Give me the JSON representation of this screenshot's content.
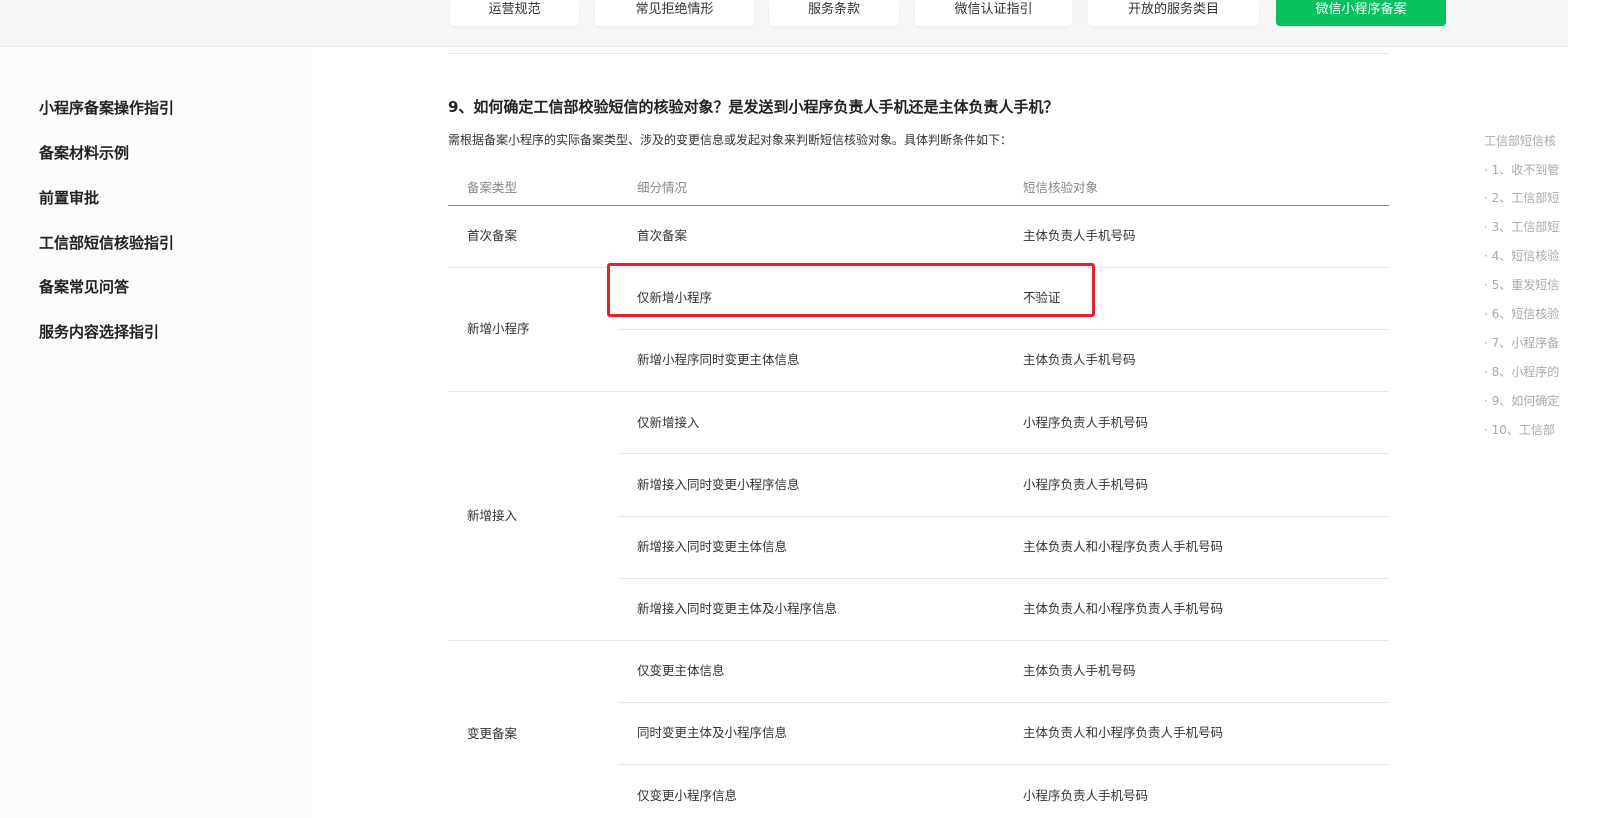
{
  "top_tabs": [
    {
      "label": "运营规范",
      "active": false
    },
    {
      "label": "常见拒绝情形",
      "active": false
    },
    {
      "label": "服务条款",
      "active": false
    },
    {
      "label": "微信认证指引",
      "active": false
    },
    {
      "label": "开放的服务类目",
      "active": false
    },
    {
      "label": "微信小程序备案",
      "active": true
    }
  ],
  "sidebar": {
    "items": [
      {
        "label": "小程序备案操作指引"
      },
      {
        "label": "备案材料示例"
      },
      {
        "label": "前置审批"
      },
      {
        "label": "工信部短信核验指引"
      },
      {
        "label": "备案常见问答"
      },
      {
        "label": "服务内容选择指引"
      }
    ]
  },
  "main": {
    "title": "9、如何确定工信部校验短信的核验对象？是发送到小程序负责人手机还是主体负责人手机？",
    "description": "需根据备案小程序的实际备案类型、涉及的变更信息或发起对象来判断短信核验对象。具体判断条件如下：",
    "table": {
      "headers": [
        "备案类型",
        "细分情况",
        "短信核验对象"
      ],
      "groups": [
        {
          "type": "首次备案",
          "rows": [
            {
              "detail": "首次备案",
              "target": "主体负责人手机号码"
            }
          ]
        },
        {
          "type": "新增小程序",
          "rows": [
            {
              "detail": "仅新增小程序",
              "target": "不验证"
            },
            {
              "detail": "新增小程序同时变更主体信息",
              "target": "主体负责人手机号码"
            }
          ]
        },
        {
          "type": "新增接入",
          "rows": [
            {
              "detail": "仅新增接入",
              "target": "小程序负责人手机号码"
            },
            {
              "detail": "新增接入同时变更小程序信息",
              "target": "小程序负责人手机号码"
            },
            {
              "detail": "新增接入同时变更主体信息",
              "target": "主体负责人和小程序负责人手机号码"
            },
            {
              "detail": "新增接入同时变更主体及小程序信息",
              "target": "主体负责人和小程序负责人手机号码"
            }
          ]
        },
        {
          "type": "变更备案",
          "rows": [
            {
              "detail": "仅变更主体信息",
              "target": "主体负责人手机号码"
            },
            {
              "detail": "同时变更主体及小程序信息",
              "target": "主体负责人和小程序负责人手机号码"
            },
            {
              "detail": "仅变更小程序信息",
              "target": "小程序负责人手机号码"
            }
          ]
        }
      ]
    }
  },
  "toc": {
    "title": "工信部短信核",
    "items": [
      "· 1、收不到管",
      "· 2、工信部短",
      "· 3、工信部短",
      "· 4、短信核验",
      "· 5、重发短信",
      "· 6、短信核验",
      "· 7、小程序备",
      "· 8、小程序的",
      "· 9、如何确定",
      "· 10、工信部"
    ]
  },
  "colors": {
    "accent": "#07c160",
    "highlight_box": "#e0242b"
  }
}
